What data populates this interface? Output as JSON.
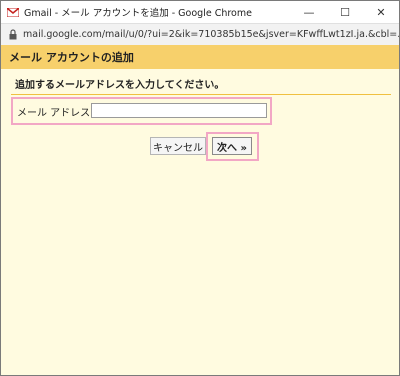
{
  "window": {
    "title": "Gmail - メール アカウントを追加 - Google Chrome",
    "icons": {
      "app": "gmail-icon",
      "minimize": "minimize-icon",
      "maximize": "maximize-icon",
      "close": "close-icon",
      "lock": "lock-icon"
    },
    "minimize_glyph": "—",
    "maximize_glyph": "☐",
    "close_glyph": "✕"
  },
  "address_bar": {
    "url": "mail.google.com/mail/u/0/?ui=2&ik=710385b15e&jsver=KFwffLwt1zI.ja.&cbl=..."
  },
  "dialog": {
    "title": "メール アカウントの追加",
    "instruction": "追加するメールアドレスを入力してください。",
    "email_label": "メール アドレス:",
    "email_value": "",
    "cancel_label": "キャンセル",
    "next_label": "次へ »"
  },
  "colors": {
    "header_bg": "#f7d06b",
    "body_bg": "#fffbe0",
    "highlight": "#f2a7c5",
    "divider": "#f0c040"
  }
}
